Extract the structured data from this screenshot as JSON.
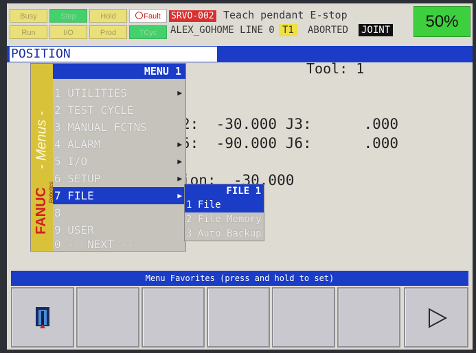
{
  "status_lights": {
    "busy": "Busy",
    "step": "Step",
    "hold": "Hold",
    "fault": "Fault",
    "run": "Run",
    "io": "I/O",
    "prod": "Prod",
    "tcyc": "TCyc"
  },
  "alarm": {
    "code": "SRVO-002",
    "message": "Teach pendant E-stop"
  },
  "program": {
    "name": "ALEX_GOHOME",
    "line": "LINE 0",
    "mode": "T1",
    "state": "ABORTED",
    "coord": "JOINT"
  },
  "override": "50%",
  "screen": {
    "title": "POSITION",
    "tool": "Tool: 1",
    "row1": "2:  -30.000 J3:      .000",
    "row2": "5:  -90.000 J6:      .000",
    "row3": "ion:  -30.000"
  },
  "menu": {
    "header": "MENU  1",
    "side_label": "- Menus -",
    "brand": "FANUC",
    "brand_sub": "Robotics",
    "items": [
      {
        "label": "1 UTILITIES",
        "arrow": "▶"
      },
      {
        "label": "2 TEST CYCLE",
        "arrow": ""
      },
      {
        "label": "3 MANUAL FCTNS",
        "arrow": ""
      },
      {
        "label": "4 ALARM",
        "arrow": "▶"
      },
      {
        "label": "5 I/O",
        "arrow": "▶"
      },
      {
        "label": "6 SETUP",
        "arrow": "▶"
      },
      {
        "label": "7 FILE",
        "arrow": "▶"
      },
      {
        "label": "8",
        "arrow": ""
      },
      {
        "label": "9 USER",
        "arrow": ""
      },
      {
        "label": "0 -- NEXT --",
        "arrow": ""
      }
    ]
  },
  "submenu": {
    "header": "FILE  1",
    "items": [
      "1 File",
      "2 File Memory",
      "3 Auto Backup"
    ]
  },
  "favorites_bar": "Menu Favorites (press and hold to set)",
  "fkeys": {
    "first_icon": "door-exit-icon",
    "last_icon": "next-arrow-icon"
  }
}
